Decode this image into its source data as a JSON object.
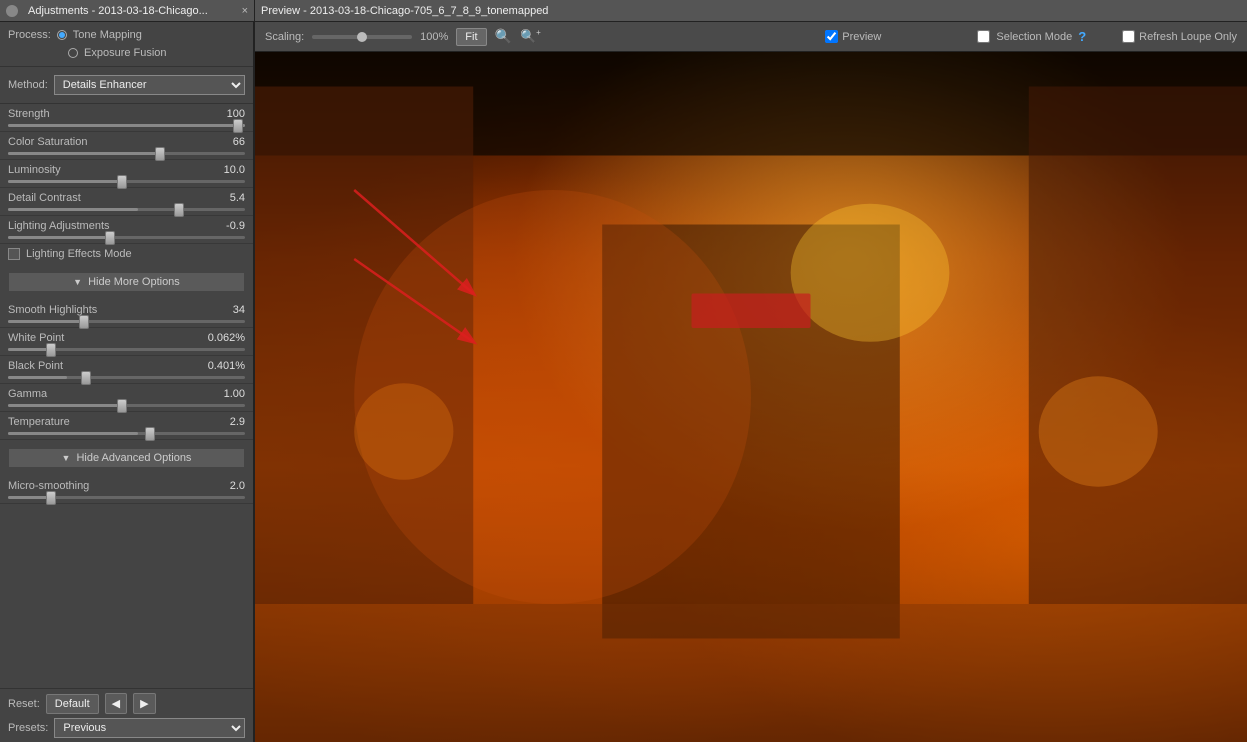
{
  "windows": {
    "adjustments": {
      "title": "Adjustments - 2013-03-18-Chicago...",
      "close_symbol": "×"
    },
    "preview": {
      "title": "Preview - 2013-03-18-Chicago-705_6_7_8_9_tonemapped"
    }
  },
  "process": {
    "label": "Process:",
    "options": [
      {
        "id": "tone_mapping",
        "label": "Tone Mapping",
        "selected": true
      },
      {
        "id": "exposure_fusion",
        "label": "Exposure Fusion",
        "selected": false
      }
    ]
  },
  "method": {
    "label": "Method:",
    "value": "Details Enhancer"
  },
  "sliders": [
    {
      "name": "Strength",
      "value": "100",
      "pct": 100
    },
    {
      "name": "Color Saturation",
      "value": "66",
      "pct": 66
    },
    {
      "name": "Luminosity",
      "value": "10.0",
      "pct": 50
    },
    {
      "name": "Detail Contrast",
      "value": "5.4",
      "pct": 55
    }
  ],
  "lighting": {
    "label": "Lighting Adjustments",
    "value": "-0.9",
    "pct": 45,
    "effects_label": "Lighting Effects Mode",
    "effects_checked": false
  },
  "more_options_btn": "Hide More Options",
  "more_sliders": [
    {
      "name": "Smooth Highlights",
      "value": "34",
      "pct": 34
    },
    {
      "name": "White Point",
      "value": "0.062%",
      "pct": 20
    },
    {
      "name": "Black Point",
      "value": "0.401%",
      "pct": 25
    },
    {
      "name": "Gamma",
      "value": "1.00",
      "pct": 50
    },
    {
      "name": "Temperature",
      "value": "2.9",
      "pct": 55
    }
  ],
  "advanced_options_btn": "Hide Advanced Options",
  "advanced_sliders": [
    {
      "name": "Micro-smoothing",
      "value": "2.0",
      "pct": 20
    }
  ],
  "bottom": {
    "reset_label": "Reset:",
    "default_btn": "Default",
    "presets_label": "Presets:",
    "previous_btn": "Previous"
  },
  "preview_toolbar": {
    "scaling_label": "Scaling:",
    "scaling_value": "100%",
    "fit_btn": "Fit",
    "zoom_in": "+",
    "zoom_out": "−",
    "preview_label": "Preview",
    "preview_checked": true,
    "selection_mode_label": "Selection Mode",
    "refresh_label": "Refresh Loupe Only"
  }
}
